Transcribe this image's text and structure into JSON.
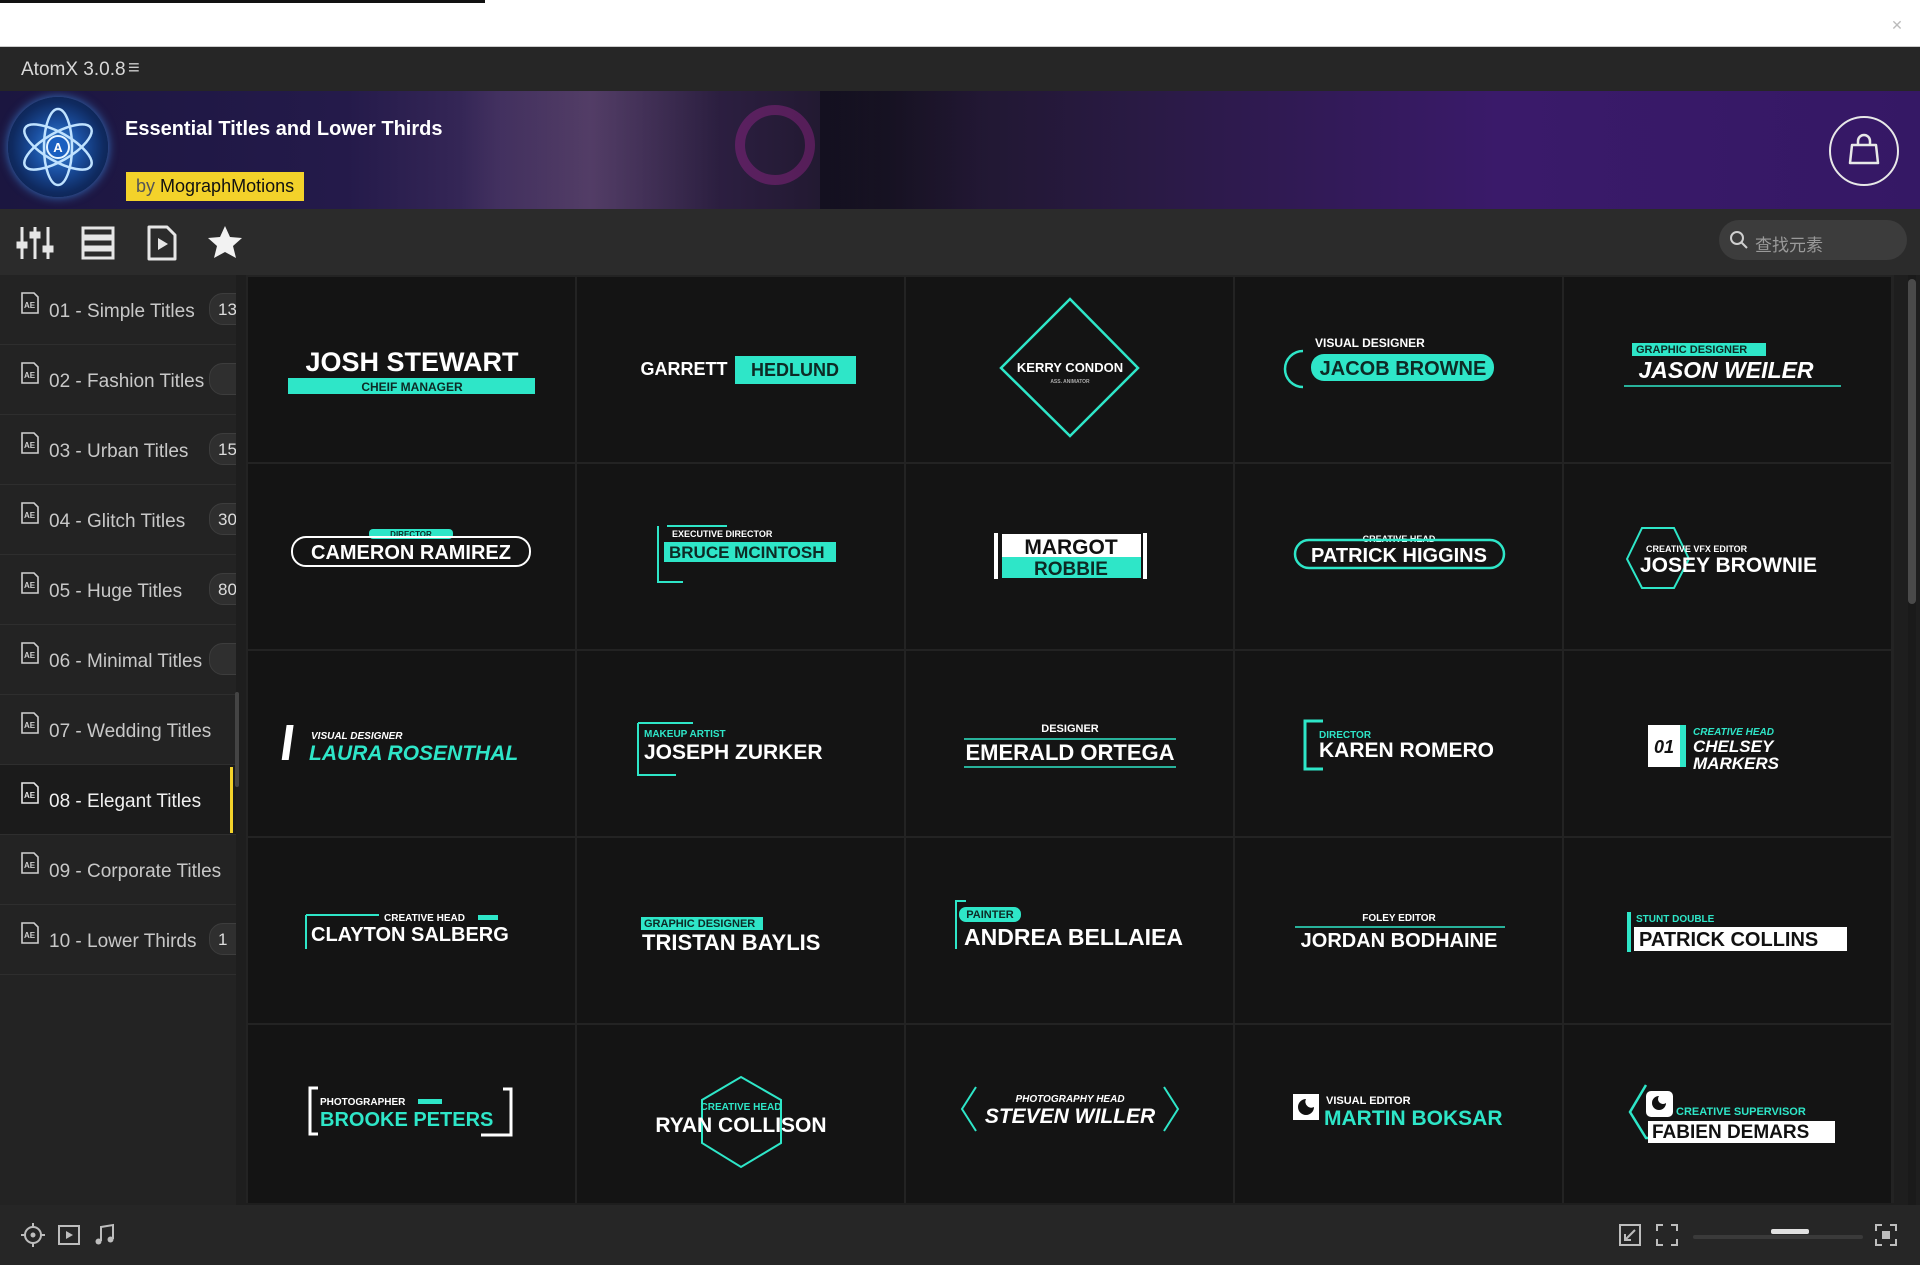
{
  "app": {
    "title": "AtomX 3.0.8",
    "menu_icon": "hamburger-icon",
    "close_icon": "close-icon"
  },
  "banner": {
    "pack_title": "Essential Titles and Lower Thirds",
    "author_prefix": "by",
    "author": "MographMotions",
    "shop_icon": "shopping-bag-icon"
  },
  "toolbar": {
    "icons": [
      "sliders-icon",
      "list-view-icon",
      "preview-play-icon",
      "favorites-star-icon"
    ],
    "search_placeholder": "查找元素"
  },
  "sidebar": {
    "items": [
      {
        "label": "01 - Simple Titles",
        "count": "13",
        "selected": false
      },
      {
        "label": "02 - Fashion Titles",
        "count": "",
        "selected": false
      },
      {
        "label": "03 - Urban Titles",
        "count": "15",
        "selected": false
      },
      {
        "label": "04 - Glitch Titles",
        "count": "30",
        "selected": false
      },
      {
        "label": "05 - Huge Titles",
        "count": "80",
        "selected": false
      },
      {
        "label": "06 - Minimal Titles",
        "count": "",
        "selected": false
      },
      {
        "label": "07 - Wedding Titles",
        "count": "",
        "selected": false
      },
      {
        "label": "08 - Elegant Titles",
        "count": "",
        "selected": true
      },
      {
        "label": "09 - Corporate Titles",
        "count": "",
        "selected": false
      },
      {
        "label": "10 - Lower Thirds",
        "count": "1",
        "selected": false
      }
    ]
  },
  "accent_color": "#2ee6c8",
  "highlight_color": "#f3d22a",
  "presets": [
    {
      "name": "JOSH STEWART",
      "role": "CHEIF MANAGER"
    },
    {
      "name": "GARRETT",
      "name2": "HEDLUND"
    },
    {
      "name": "KERRY CONDON",
      "role": "ASS. ANIMATOR"
    },
    {
      "name": "JACOB BROWNE",
      "role": "VISUAL DESIGNER"
    },
    {
      "name": "JASON WEILER",
      "role": "GRAPHIC DESIGNER"
    },
    {
      "name": "CAMERON RAMIREZ",
      "role": "DIRECTOR"
    },
    {
      "name": "BRUCE MCINTOSH",
      "role": "EXECUTIVE DIRECTOR"
    },
    {
      "name": "MARGOT",
      "name2": "ROBBIE"
    },
    {
      "name": "PATRICK HIGGINS",
      "role": "CREATIVE HEAD"
    },
    {
      "name": "JOSEY BROWNIE",
      "role": "CREATIVE VFX EDITOR"
    },
    {
      "name": "LAURA ROSENTHAL",
      "role": "VISUAL DESIGNER"
    },
    {
      "name": "JOSEPH ZURKER",
      "role": "MAKEUP ARTIST"
    },
    {
      "name": "EMERALD ORTEGA",
      "role": "DESIGNER"
    },
    {
      "name": "KAREN ROMERO",
      "role": "DIRECTOR"
    },
    {
      "name": "CHELSEY",
      "name2": "MARKERS",
      "role": "CREATIVE HEAD",
      "number": "01"
    },
    {
      "name": "CLAYTON SALBERG",
      "role": "CREATIVE HEAD"
    },
    {
      "name": "TRISTAN BAYLIS",
      "role": "GRAPHIC DESIGNER"
    },
    {
      "name": "ANDREA BELLAIEA",
      "role": "PAINTER"
    },
    {
      "name": "JORDAN BODHAINE",
      "role": "FOLEY EDITOR"
    },
    {
      "name": "PATRICK COLLINS",
      "role": "STUNT DOUBLE"
    },
    {
      "name": "BROOKE PETERS",
      "role": "PHOTOGRAPHER"
    },
    {
      "name": "RYAN COLLISON",
      "role": "CREATIVE HEAD"
    },
    {
      "name": "STEVEN WILLER",
      "role": "PHOTOGRAPHY HEAD"
    },
    {
      "name": "MARTIN BOKSAR",
      "role": "VISUAL EDITOR"
    },
    {
      "name": "FABIEN DEMARS",
      "role": "CREATIVE SUPERVISOR"
    }
  ],
  "bottombar": {
    "left_icons": [
      "target-icon",
      "video-icon",
      "music-icon"
    ],
    "right_icons": [
      "shrink-icon",
      "fit-icon",
      "expand-icon"
    ],
    "zoom_level": 0.5
  }
}
